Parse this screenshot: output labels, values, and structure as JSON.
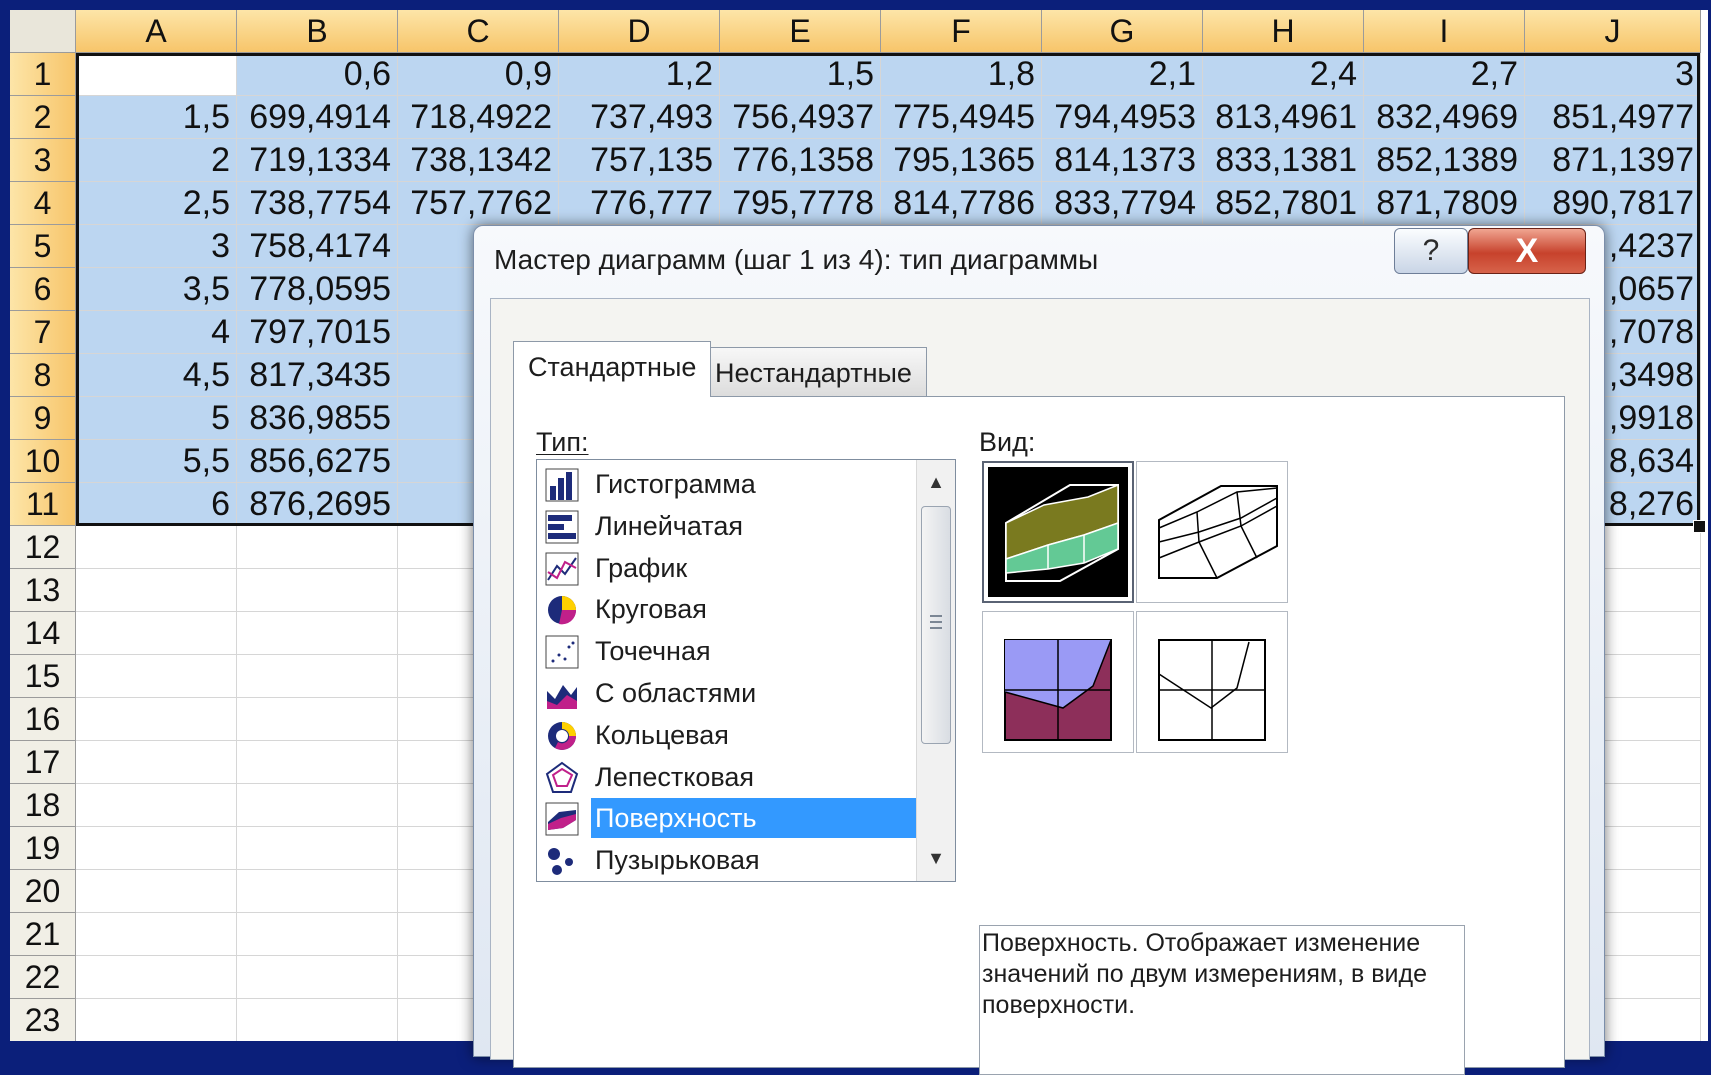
{
  "sheet": {
    "columns": [
      "A",
      "B",
      "C",
      "D",
      "E",
      "F",
      "G",
      "H",
      "I",
      "J"
    ],
    "rows": [
      "1",
      "2",
      "3",
      "4",
      "5",
      "6",
      "7",
      "8",
      "9",
      "10",
      "11",
      "12",
      "13",
      "14",
      "15",
      "16",
      "17",
      "18",
      "19",
      "20",
      "21",
      "22",
      "23"
    ],
    "cells": [
      [
        "",
        "0,6",
        "0,9",
        "1,2",
        "1,5",
        "1,8",
        "2,1",
        "2,4",
        "2,7",
        "3"
      ],
      [
        "1,5",
        "699,4914",
        "718,4922",
        "737,493",
        "756,4937",
        "775,4945",
        "794,4953",
        "813,4961",
        "832,4969",
        "851,4977"
      ],
      [
        "2",
        "719,1334",
        "738,1342",
        "757,135",
        "776,1358",
        "795,1365",
        "814,1373",
        "833,1381",
        "852,1389",
        "871,1397"
      ],
      [
        "2,5",
        "738,7754",
        "757,7762",
        "776,777",
        "795,7778",
        "814,7786",
        "833,7794",
        "852,7801",
        "871,7809",
        "890,7817"
      ],
      [
        "3",
        "758,4174",
        "777",
        "",
        "",
        "",
        "",
        "",
        "",
        ",4237"
      ],
      [
        "3,5",
        "778,0595",
        "797",
        "",
        "",
        "",
        "",
        "",
        "",
        ",0657"
      ],
      [
        "4",
        "797,7015",
        "816",
        "",
        "",
        "",
        "",
        "",
        "",
        ",7078"
      ],
      [
        "4,5",
        "817,3435",
        "836",
        "",
        "",
        "",
        "",
        "",
        "",
        ",3498"
      ],
      [
        "5",
        "836,9855",
        "855",
        "",
        "",
        "",
        "",
        "",
        "",
        ",9918"
      ],
      [
        "5,5",
        "856,6275",
        "875",
        "",
        "",
        "",
        "",
        "",
        "",
        "8,634"
      ],
      [
        "6",
        "876,2695",
        "895",
        "",
        "",
        "",
        "",
        "",
        "",
        "8,276"
      ]
    ]
  },
  "dialog": {
    "title": "Мастер диаграмм (шаг 1 из 4): тип диаграммы",
    "help_label": "?",
    "close_label": "X",
    "tabs": [
      {
        "label": "Стандартные",
        "active": true
      },
      {
        "label": "Нестандартные",
        "active": false
      }
    ],
    "type_label": "Тип:",
    "view_label": "Вид:",
    "chart_types": [
      {
        "label": "Гистограмма",
        "icon": "column-chart-icon"
      },
      {
        "label": "Линейчатая",
        "icon": "bar-chart-icon"
      },
      {
        "label": "График",
        "icon": "line-chart-icon"
      },
      {
        "label": "Круговая",
        "icon": "pie-chart-icon"
      },
      {
        "label": "Точечная",
        "icon": "scatter-chart-icon"
      },
      {
        "label": "С областями",
        "icon": "area-chart-icon"
      },
      {
        "label": "Кольцевая",
        "icon": "doughnut-chart-icon"
      },
      {
        "label": "Лепестковая",
        "icon": "radar-chart-icon"
      },
      {
        "label": "Поверхность",
        "icon": "surface-chart-icon",
        "selected": true
      },
      {
        "label": "Пузырьковая",
        "icon": "bubble-chart-icon"
      }
    ],
    "description": "Поверхность. Отображает изменение значений по двум измерениям, в виде поверхности."
  },
  "colors": {
    "header_fill": "#f7c56a",
    "selection_fill": "#bcd6f1",
    "list_highlight": "#3399ff",
    "close_red": "#c7422c",
    "background_blue": "#0b1f7a"
  }
}
